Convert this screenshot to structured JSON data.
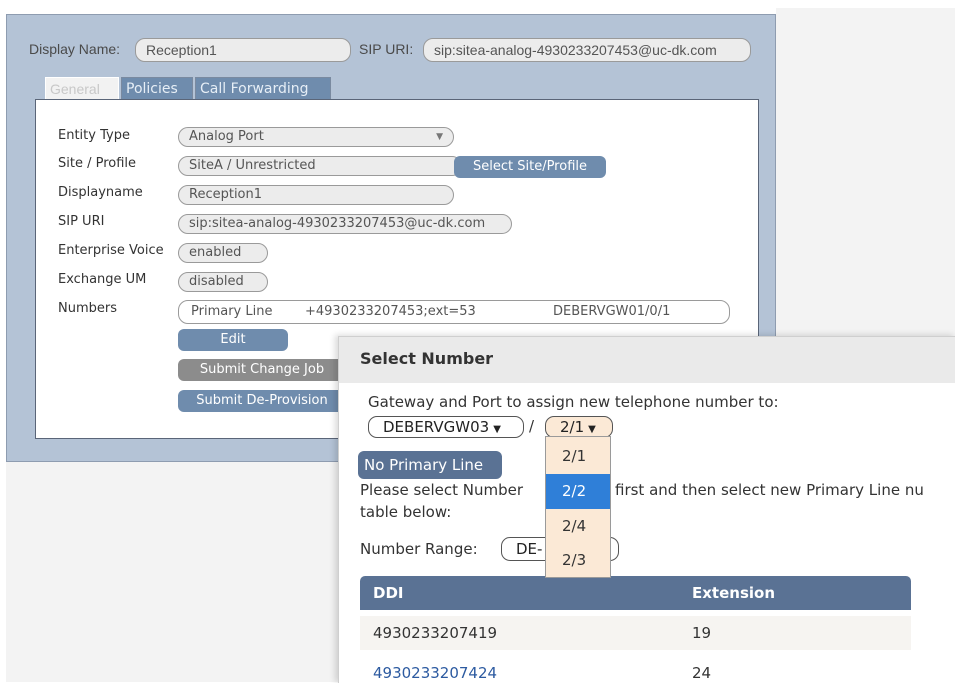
{
  "top": {
    "display_name_label": "Display Name:",
    "display_name_value": "Reception1",
    "sip_uri_label": "SIP URI:",
    "sip_uri_value": "sip:sitea-analog-4930233207453@uc-dk.com"
  },
  "tabs": [
    {
      "label": "General"
    },
    {
      "label": "Policies"
    },
    {
      "label": "Call Forwarding"
    }
  ],
  "form": {
    "entity_type_label": "Entity Type",
    "entity_type_value": "Analog Port",
    "site_label": "Site / Profile",
    "site_value": "SiteA / Unrestricted",
    "select_site_button": "Select Site/Profile",
    "displayname_label": "Displayname",
    "displayname_value": "Reception1",
    "sip_uri_label": "SIP URI",
    "sip_uri_value": "sip:sitea-analog-4930233207453@uc-dk.com",
    "enterprise_voice_label": "Enterprise Voice",
    "enterprise_voice_value": "enabled",
    "exchange_um_label": "Exchange UM",
    "exchange_um_value": "disabled",
    "numbers_label": "Numbers",
    "numbers_line_type": "Primary Line",
    "numbers_number": "+4930233207453;ext=53",
    "numbers_port": "DEBERVGW01/0/1",
    "edit_button": "Edit",
    "submit_change_button": "Submit Change Job",
    "submit_deprovision_button": "Submit De-Provision"
  },
  "modal": {
    "title": "Select Number",
    "gateway_text": "Gateway and Port to assign new telephone number to:",
    "gateway_value": "DEBERVGW03",
    "separator": "/",
    "port_value": "2/1",
    "no_primary_button": "No Primary Line",
    "instruction_part1": "Please select Number",
    "instruction_part2": "first and then select new Primary Line nu",
    "instruction_line2": "table below:",
    "number_range_label": "Number Range:",
    "number_range_value": "DE-",
    "table": {
      "columns": [
        "DDI",
        "Extension"
      ],
      "rows": [
        {
          "ddi": "4930233207419",
          "ext": "19"
        },
        {
          "ddi": "4930233207424",
          "ext": "24"
        }
      ]
    }
  },
  "port_options": [
    "2/1",
    "2/2",
    "2/4",
    "2/3"
  ],
  "selected_port_option": "2/2"
}
